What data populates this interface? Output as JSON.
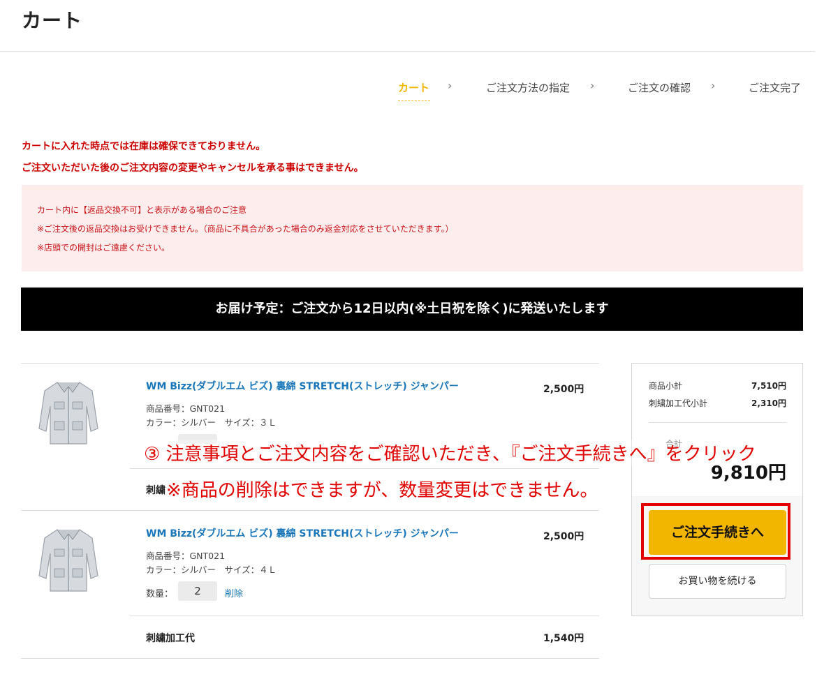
{
  "header": {
    "title": "カート"
  },
  "steps": [
    {
      "label": "カート",
      "active": true
    },
    {
      "label": "ご注文方法の指定",
      "active": false
    },
    {
      "label": "ご注文の確認",
      "active": false
    },
    {
      "label": "ご注文完了",
      "active": false
    }
  ],
  "step_separator": "›",
  "warnings": [
    "カートに入れた時点では在庫は確保できておりません。",
    "ご注文いただいた後のご注文内容の変更やキャンセルを承る事はできません。"
  ],
  "notice": {
    "title": "カート内に【返品交換不可】と表示がある場合のご注意",
    "lines": [
      "※ご注文後の返品交換はお受けできません。（商品に不具合があった場合のみ返金対応をさせていただきます。）",
      "※店頭での開封はご遠慮ください。"
    ]
  },
  "delivery": {
    "text": "お届け予定：ご注文から12日以内(※土日祝を除く)に発送いたします"
  },
  "items": [
    {
      "name": "WM Bizz(ダブルエム ビズ) 裏綿 STRETCH(ストレッチ) ジャンパー",
      "product_number": "商品番号：GNT021",
      "variant": "カラー：シルバー　サイズ：３Ｌ",
      "price": "2,500円",
      "embroidery_label": "刺繍"
    },
    {
      "name": "WM Bizz(ダブルエム ビズ) 裏綿 STRETCH(ストレッチ) ジャンパー",
      "product_number": "商品番号：GNT021",
      "variant": "カラー：シルバー　サイズ：４Ｌ",
      "price": "2,500円",
      "quantity_label": "数量：",
      "quantity": "2",
      "delete_label": "削除",
      "embroidery_label": "刺繍加工代",
      "embroidery_price": "1,540円"
    }
  ],
  "summary": {
    "subtotal_label": "商品小計",
    "subtotal": "7,510円",
    "embroidery_label": "刺繍加工代小計",
    "embroidery": "2,310円",
    "total_label": "合計",
    "total": "9,810円",
    "checkout_button": "ご注文手続きへ",
    "continue_button": "お買い物を続ける"
  },
  "annotation": {
    "line1": "③ 注意事項とご注文内容をご確認いただき､『ご注文手続きへ』をクリック",
    "line2": "※商品の削除はできますが、数量変更はできません。"
  },
  "colors": {
    "accent": "#f2b500",
    "warning": "#cc0000",
    "link": "#1976b8",
    "annotation": "#e00000",
    "notice_bg": "#fdeded"
  }
}
